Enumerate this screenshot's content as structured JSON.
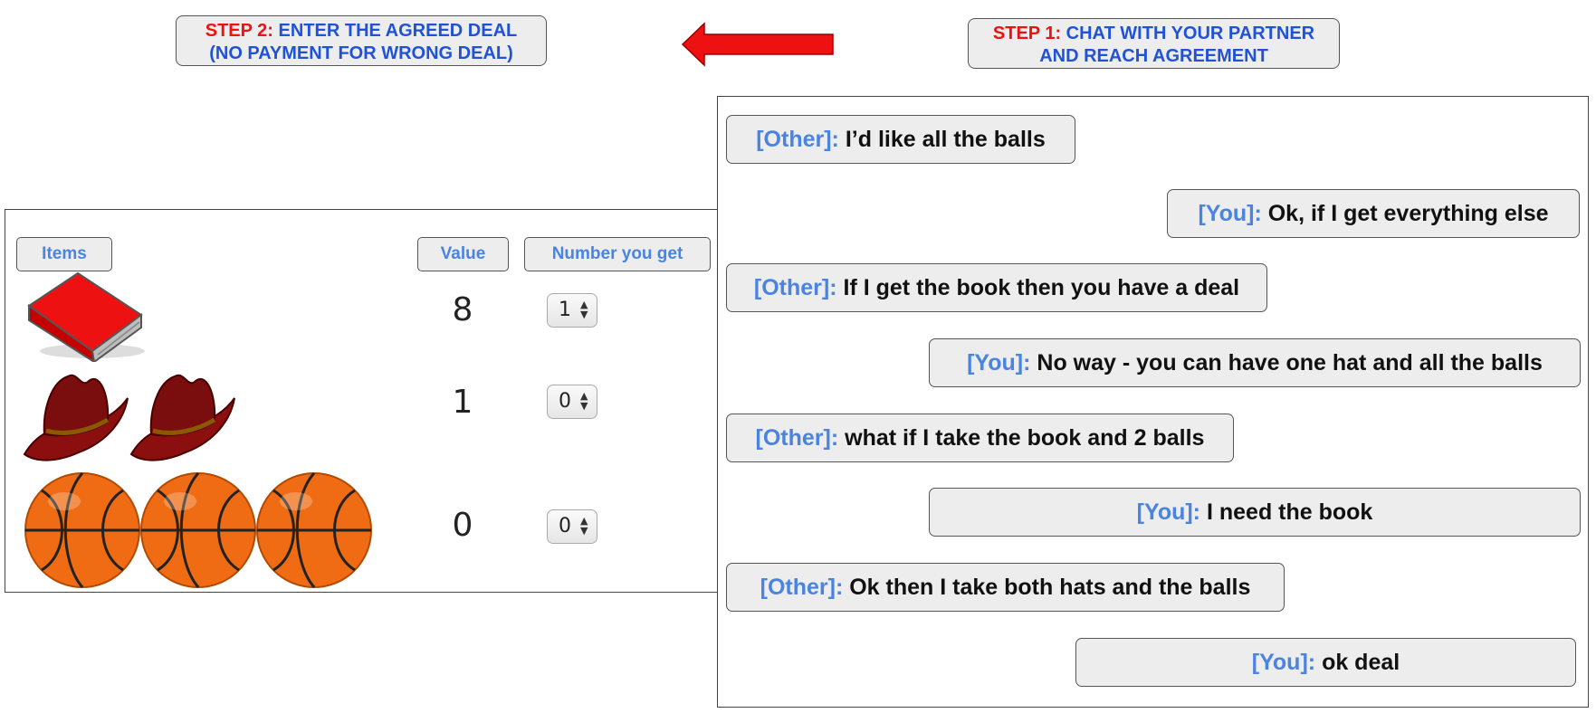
{
  "step2": {
    "label": "STEP 2:",
    "text_line1": "ENTER THE AGREED DEAL",
    "text_line2": "(NO PAYMENT FOR WRONG DEAL)"
  },
  "step1": {
    "label": "STEP 1:",
    "text_line1": "CHAT WITH YOUR PARTNER",
    "text_line2": "AND REACH AGREEMENT"
  },
  "arrow": {
    "icon": "left-arrow-icon",
    "color": "#ee1111"
  },
  "deal": {
    "headers": {
      "items": "Items",
      "value": "Value",
      "number": "Number you get"
    },
    "rows": [
      {
        "item": "book",
        "icon": "book-icon",
        "count_shown": 1,
        "value": "8",
        "number": "1"
      },
      {
        "item": "hat",
        "icon": "hat-icon",
        "count_shown": 2,
        "value": "1",
        "number": "0"
      },
      {
        "item": "ball",
        "icon": "basketball-icon",
        "count_shown": 3,
        "value": "0",
        "number": "0"
      }
    ]
  },
  "chat": {
    "messages": [
      {
        "speaker": "[Other]:",
        "text": "I’d like all the balls"
      },
      {
        "speaker": "[You]:",
        "text": "Ok, if I get everything else"
      },
      {
        "speaker": "[Other]:",
        "text": "If I get the book then you have a deal"
      },
      {
        "speaker": "[You]:",
        "text": "No way - you can have one hat and all the balls"
      },
      {
        "speaker": "[Other]:",
        "text": "what if I take the book and 2 balls"
      },
      {
        "speaker": "[You]:",
        "text": "I need the book"
      },
      {
        "speaker": "[Other]:",
        "text": "Ok then I take both hats and the balls"
      },
      {
        "speaker": "[You]:",
        "text": "ok deal"
      }
    ]
  },
  "colors": {
    "step_red": "#ee1111",
    "step_blue": "#1f52d6",
    "speaker_blue": "#4a83e0",
    "box_bg": "#ededed"
  }
}
